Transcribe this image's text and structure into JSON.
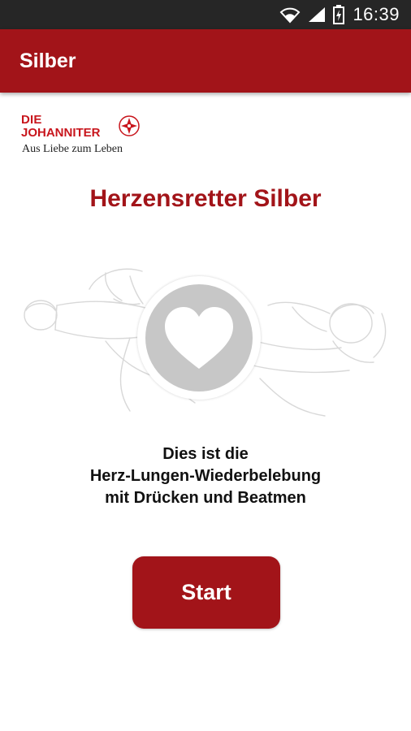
{
  "status_bar": {
    "time": "16:39",
    "icons": [
      "wifi-icon",
      "signal-icon",
      "battery-icon"
    ]
  },
  "app_bar": {
    "title": "Silber",
    "color": "#a21419"
  },
  "logo": {
    "line1": "DIE",
    "line2": "JOHANNITER",
    "tagline": "Aus Liebe zum Leben",
    "icon": "johanniter-cross-icon"
  },
  "main": {
    "title": "Herzensretter Silber",
    "heart_icon": "heart-icon",
    "description_lines": [
      "Dies ist die",
      "Herz-Lungen-Wiederbelebung",
      "mit Drücken und Beatmen"
    ]
  },
  "start_button": {
    "label": "Start",
    "color": "#a21419"
  }
}
